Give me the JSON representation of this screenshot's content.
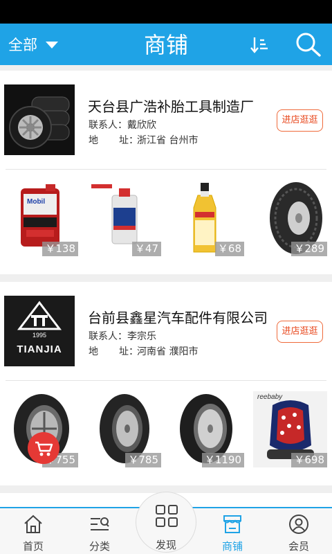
{
  "header": {
    "filter_label": "全部",
    "title": "商铺",
    "bg_color": "#1fa3e6"
  },
  "shops": [
    {
      "name": "天台县广浩补胎工具制造厂",
      "contact": "联系人：戴欣欣",
      "address_key_a": "地",
      "address_key_b": "址：",
      "address_value": "浙江省 台州市",
      "visit_label": "进店逛逛",
      "logo_icon": "tire-stack-logo",
      "products": [
        {
          "icon": "engine-oil-jug-icon",
          "price": "￥138"
        },
        {
          "icon": "brake-fluid-bottle-icon",
          "price": "￥47"
        },
        {
          "icon": "additive-bottle-icon",
          "price": "￥68"
        },
        {
          "icon": "tire-icon",
          "price": "￥289"
        }
      ]
    },
    {
      "name": "台前县鑫星汽车配件有限公司",
      "contact": "联系人：李宗乐",
      "address_key_a": "地",
      "address_key_b": "址：",
      "address_value": "河南省 濮阳市",
      "visit_label": "进店逛逛",
      "logo_icon": "tianjia-logo",
      "logo_text": "TIANJIA",
      "logo_year": "1995",
      "products": [
        {
          "icon": "tire-icon",
          "price": "￥755"
        },
        {
          "icon": "tire-icon",
          "price": "￥785"
        },
        {
          "icon": "tire-icon",
          "price": "￥1190"
        },
        {
          "icon": "child-car-seat-icon",
          "price": "￥698",
          "brand_text": "reebaby"
        }
      ]
    }
  ],
  "tabbar": {
    "items": [
      {
        "label": "首页",
        "icon": "home-icon"
      },
      {
        "label": "分类",
        "icon": "category-icon"
      },
      {
        "label": "发现",
        "icon": "grid-icon"
      },
      {
        "label": "商铺",
        "icon": "store-icon",
        "active": true
      },
      {
        "label": "会员",
        "icon": "user-icon"
      }
    ],
    "accent_color": "#1fa3e6"
  },
  "accent": {
    "visit_button": "#e8471c"
  }
}
